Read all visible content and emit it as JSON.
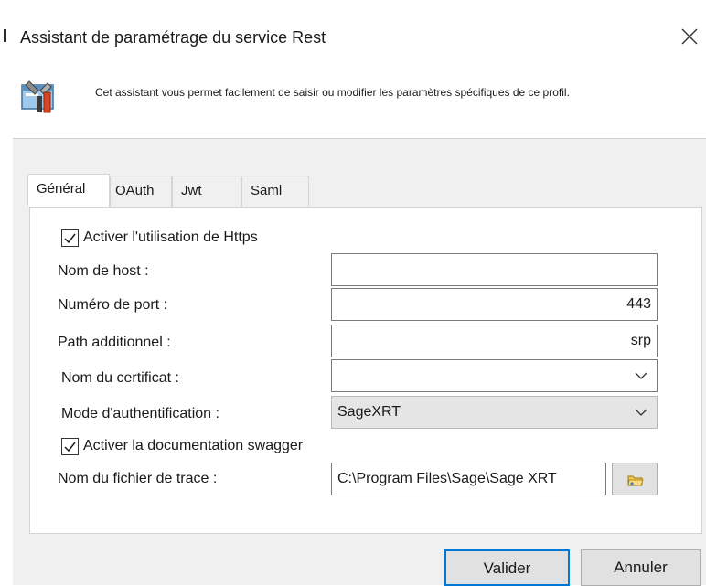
{
  "window": {
    "title": "Assistant de paramétrage du service Rest",
    "description": "Cet assistant vous permet facilement de saisir ou modifier les paramètres spécifiques de ce profil."
  },
  "tabs": [
    {
      "label": "Général",
      "active": true
    },
    {
      "label": "OAuth",
      "active": false
    },
    {
      "label": "Jwt",
      "active": false
    },
    {
      "label": "Saml",
      "active": false
    }
  ],
  "form": {
    "https_checkbox": {
      "label": "Activer l'utilisation de Https",
      "checked": true
    },
    "host": {
      "label": "Nom de host :",
      "value": ""
    },
    "port": {
      "label": "Numéro de port :",
      "value": "443"
    },
    "path": {
      "label": "Path additionnel :",
      "value": "srp"
    },
    "certificate": {
      "label": "Nom du certificat :",
      "value": ""
    },
    "auth_mode": {
      "label": "Mode d'authentification :",
      "value": "SageXRT"
    },
    "swagger_checkbox": {
      "label": "Activer la documentation swagger",
      "checked": true
    },
    "trace_file": {
      "label": "Nom du fichier de trace :",
      "value": "C:\\Program Files\\Sage\\Sage XRT"
    }
  },
  "buttons": {
    "ok": "Valider",
    "cancel": "Annuler"
  },
  "icons": {
    "close": "close-icon",
    "header": "tools-icon",
    "browse": "folder-icon",
    "chevron": "chevron-down-icon",
    "check": "checkmark-icon"
  },
  "colors": {
    "accent": "#0078d7",
    "dialog_body": "#f0f0f0"
  }
}
